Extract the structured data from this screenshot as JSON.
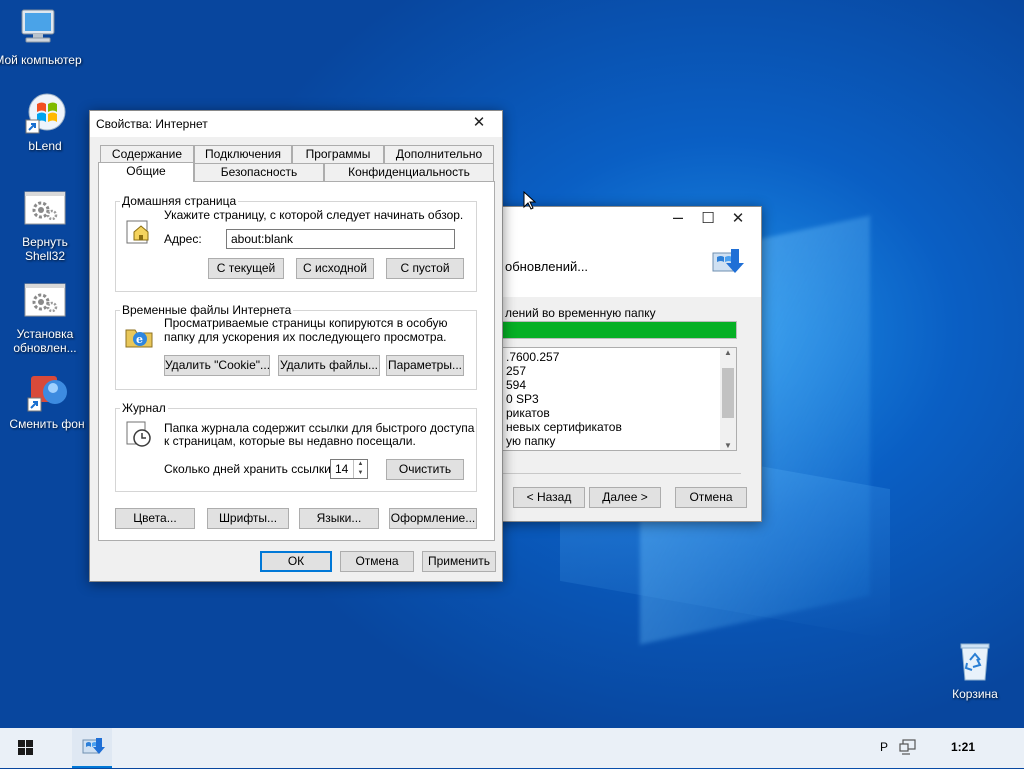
{
  "desktop": {
    "icons": [
      {
        "label": "Мой компьютер",
        "icon": "computer-icon"
      },
      {
        "label": "bLend",
        "icon": "windows-logo-icon"
      },
      {
        "label": "Вернуть Shell32",
        "icon": "settings-gears-icon"
      },
      {
        "label": "Установка обновлен...",
        "icon": "settings-gears-icon"
      },
      {
        "label": "Сменить фон",
        "icon": "change-wallpaper-icon"
      },
      {
        "label": "Корзина",
        "icon": "recycle-bin-icon"
      }
    ]
  },
  "bg_window": {
    "title_partial": "обновлений...",
    "progress_label": "лений во временную папку",
    "progress": 1.0,
    "progress_color": "#06b025",
    "log_lines": [
      ".7600.257",
      "257",
      "594",
      "0 SP3",
      "рикатов",
      "невых сертификатов",
      "ую папку"
    ],
    "back_label": "< Назад",
    "next_label": "Далее >",
    "cancel_label": "Отмена"
  },
  "dialog": {
    "title": "Свойства: Интернет",
    "tabs_row1": [
      "Содержание",
      "Подключения",
      "Программы",
      "Дополнительно"
    ],
    "tabs_row2": [
      "Общие",
      "Безопасность",
      "Конфиденциальность"
    ],
    "home": {
      "title": "Домашняя страница",
      "desc": "Укажите страницу, с которой следует начинать обзор.",
      "address_label": "Адрес:",
      "address_value": "about:blank",
      "btn_current": "С текущей",
      "btn_default": "С исходной",
      "btn_blank": "С пустой"
    },
    "temp": {
      "title": "Временные файлы Интернета",
      "desc1": "Просматриваемые страницы копируются в особую",
      "desc2": "папку для ускорения их последующего просмотра.",
      "btn_cookies": "Удалить \"Cookie\"...",
      "btn_files": "Удалить файлы...",
      "btn_params": "Параметры..."
    },
    "history": {
      "title": "Журнал",
      "desc1": "Папка журнала содержит ссылки для быстрого доступа",
      "desc2": "к страницам, которые вы недавно посещали.",
      "days_label": "Сколько дней хранить ссылки:",
      "days_value": "14",
      "btn_clear": "Очистить"
    },
    "btn_colors": "Цвета...",
    "btn_fonts": "Шрифты...",
    "btn_languages": "Языки...",
    "btn_design": "Оформление...",
    "ok": "ОК",
    "cancel": "Отмена",
    "apply": "Применить"
  },
  "taskbar": {
    "lang": "Р",
    "time": "1:21"
  },
  "colors": {
    "accent": "#0078d7",
    "wallpaper": "#0a5fc4"
  }
}
